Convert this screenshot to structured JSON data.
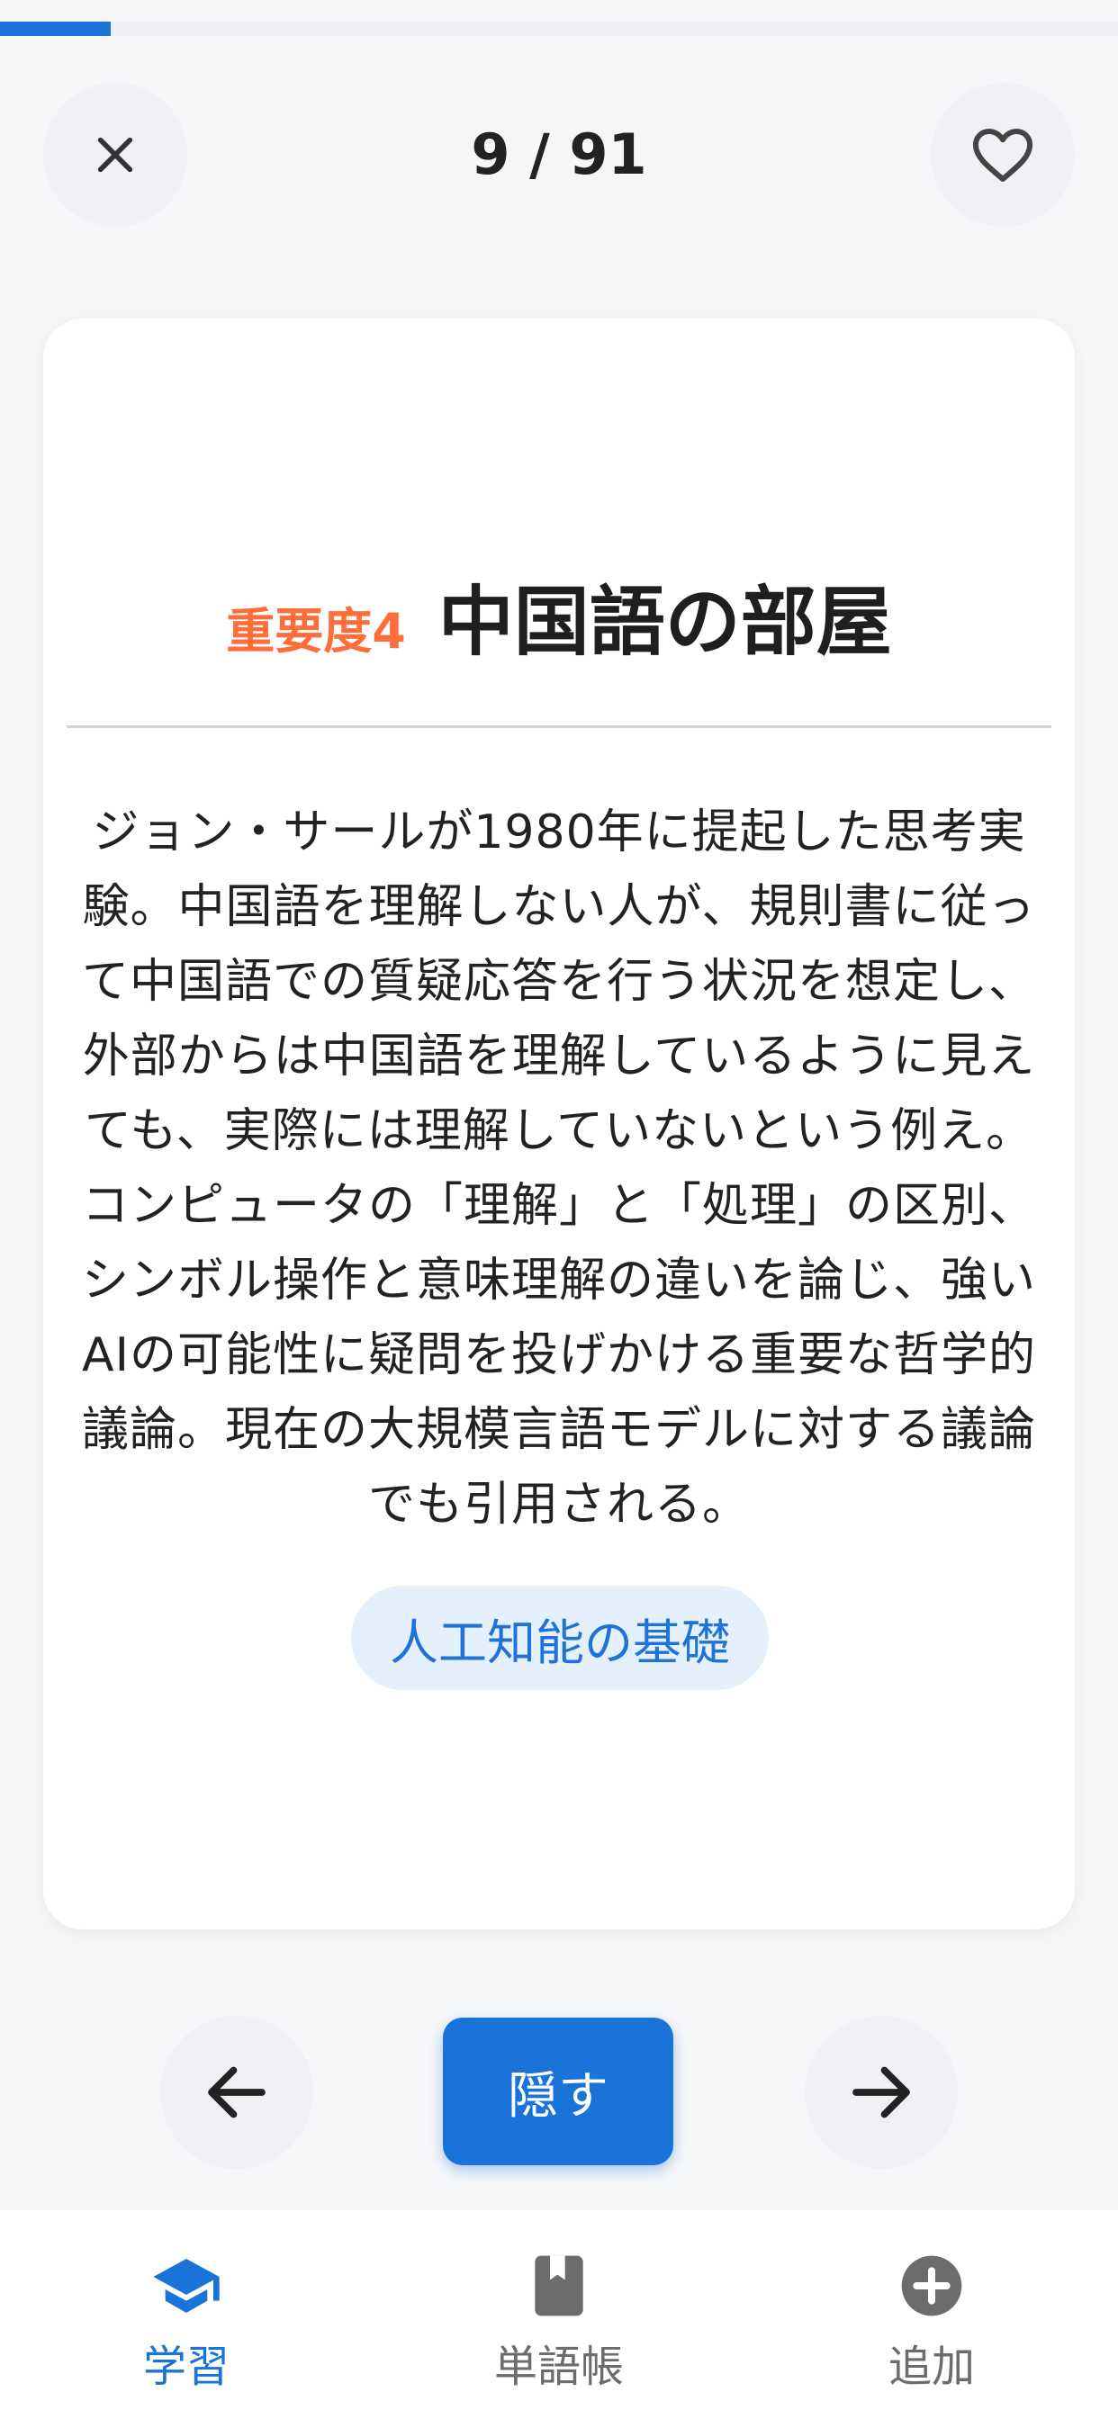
{
  "progress": {
    "current": 9,
    "total": 91,
    "fraction": 0.0989
  },
  "header": {
    "counter_text": "9 / 91"
  },
  "card": {
    "importance": "重要度4",
    "term": "中国語の部屋",
    "definition": "ジョン・サールが1980年に提起した思考実験。中国語を理解しない人が、規則書に従って中国語での質疑応答を行う状況を想定し、外部からは中国語を理解しているように見えても、実際には理解していないという例え。コンピュータの「理解」と「処理」の区別、シンボル操作と意味理解の違いを論じ、強いAIの可能性に疑問を投げかける重要な哲学的議論。現在の大規模言語モデルに対する議論でも引用される。",
    "category": "人工知能の基礎"
  },
  "controls": {
    "hide_label": "隠す"
  },
  "bottom_nav": {
    "items": [
      {
        "label": "学習",
        "icon": "graduation-cap-icon",
        "active": true
      },
      {
        "label": "単語帳",
        "icon": "book-icon",
        "active": false
      },
      {
        "label": "追加",
        "icon": "add-circle-icon",
        "active": false
      }
    ]
  },
  "colors": {
    "accent": "#1a73d9",
    "importance": "#ff6d3a",
    "tag_bg": "#e4f0fb",
    "tag_text": "#1f73d6",
    "inactive": "#6c6c6c"
  }
}
